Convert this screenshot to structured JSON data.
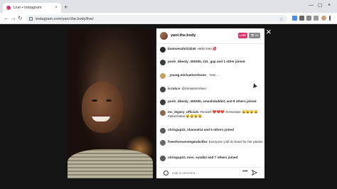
{
  "browser": {
    "tab_title": "Live • Instagram",
    "tab_close": "×",
    "new_tab": "+",
    "url": "instagram.com/yani.the.body/live/",
    "back": "←",
    "forward": "→",
    "reload": "↻",
    "bookmark": "☆",
    "minimize": "—",
    "maximize": "☐",
    "window_close": "×"
  },
  "live": {
    "close": "×",
    "username": "yani.the.body",
    "live_badge": "LIVE",
    "viewer_count": "👁 93",
    "comments": [
      {
        "user": "biomvesidol13240",
        "text": "Hello love 💋",
        "avatar": "#2a2a2a"
      },
      {
        "user": "pooh_dbeoty_305305, 231_gap and 1 other joined",
        "text": "",
        "avatar": "#3b3b3b"
      },
      {
        "user": "_young.michaelcorleone_",
        "text": "Yani…",
        "avatar": "#c9a05a"
      },
      {
        "user": "is.tulu.e",
        "text": "@doniazemotion",
        "avatar": "#444"
      },
      {
        "user": "pooh_dbeoty_305305, smashdaddie1 and 6 others joined",
        "text": "",
        "avatar": "#3b3b3b"
      },
      {
        "user": "mc_legacy_official1",
        "text": "#smash ❤️❤️❤️ #creampie 😩😩😩😩 #atherholes 😩😩😩😩",
        "avatar": "#8a6a4a"
      },
      {
        "user": "chrisgup22, nhansel14 and 5 others joined",
        "text": "",
        "avatar": "#5a5a5a"
      },
      {
        "user": "freesforeverslegendsiifex",
        "text": "Everyone y'all do heart for her please",
        "avatar": "#6a6a6a"
      },
      {
        "user": "chrisgup22, mon_eytalk2 and 7 others joined",
        "text": "",
        "avatar": "#5a5a5a"
      }
    ],
    "comment_placeholder": "Add a comment…",
    "more": "•••"
  }
}
